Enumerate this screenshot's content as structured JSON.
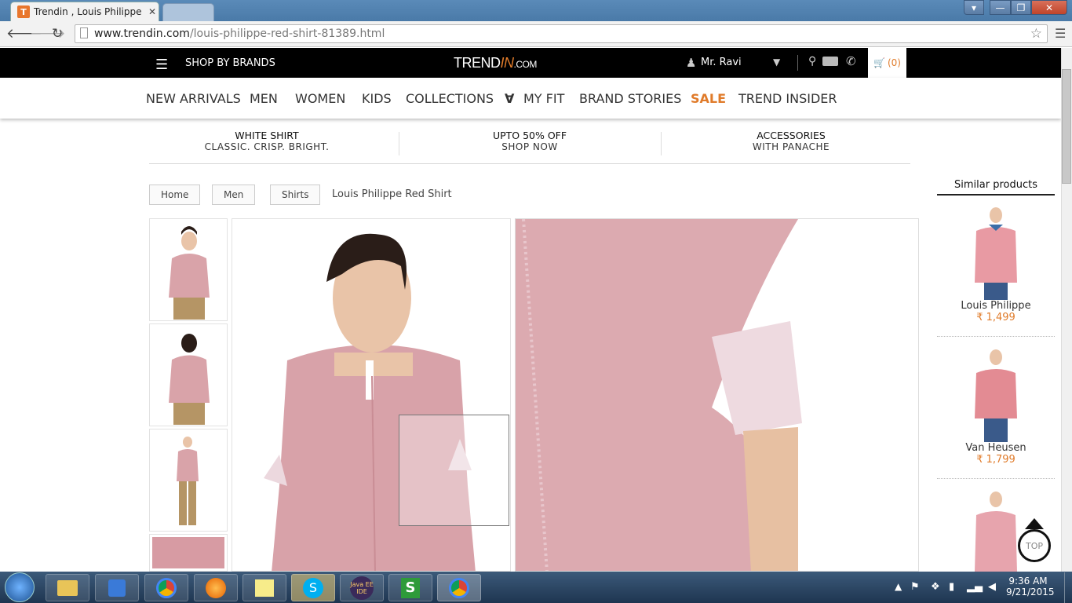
{
  "browser": {
    "tab_title": "Trendin , Louis Philippe Re",
    "tab_favicon": "T",
    "url_host": "www.trendin.com",
    "url_path": "/louis-philippe-red-shirt-81389.html"
  },
  "header": {
    "shop_by_brands": "SHOP BY BRANDS",
    "logo_main": "TREND",
    "logo_accent": "IN",
    "logo_suffix": ".COM",
    "user_name": "Mr. Ravi",
    "cart": "(0)"
  },
  "nav": {
    "items": [
      "NEW ARRIVALS",
      "MEN",
      "WOMEN",
      "KIDS",
      "COLLECTIONS",
      "MY FIT",
      "BRAND STORIES",
      "SALE",
      "TREND INSIDER"
    ]
  },
  "promos": [
    {
      "title": "WHITE SHIRT",
      "subtitle": "CLASSIC. CRISP. BRIGHT."
    },
    {
      "title": "UPTO 50% OFF",
      "subtitle": "SHOP NOW"
    },
    {
      "title": "ACCESSORIES",
      "subtitle": "WITH PANACHE"
    }
  ],
  "breadcrumb": {
    "items": [
      "Home",
      "Men",
      "Shirts"
    ],
    "current": "Louis Philippe Red Shirt"
  },
  "similar": {
    "title": "Similar products",
    "items": [
      {
        "name": "Louis Philippe",
        "price": "1,499"
      },
      {
        "name": "Van Heusen",
        "price": "1,799"
      }
    ]
  },
  "top_button": "TOP",
  "colors": {
    "accent": "#e07b2a",
    "header_bg": "#000000",
    "shirt": "#d8a0a6"
  },
  "taskbar": {
    "time": "9:36 AM",
    "date": "9/21/2015",
    "java_label": "Java EE IDE"
  }
}
